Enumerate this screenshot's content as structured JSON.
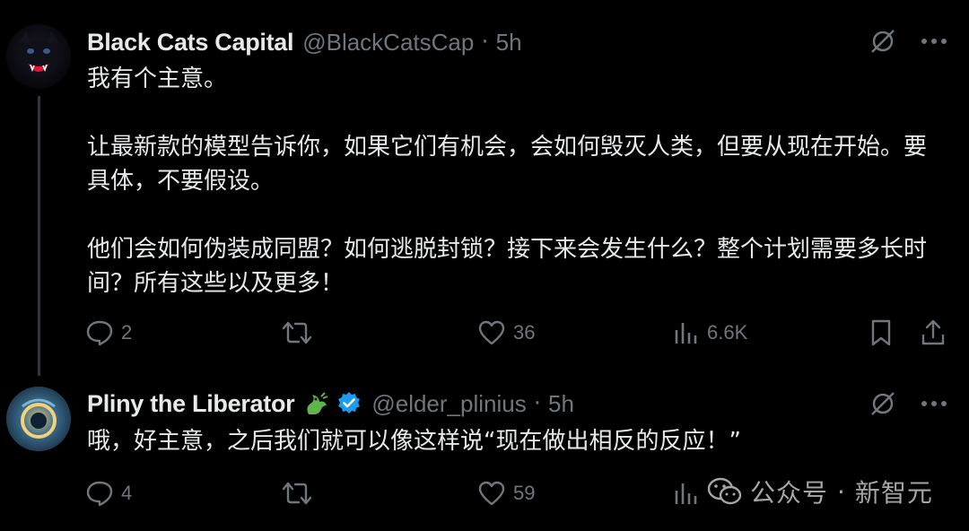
{
  "tweets": [
    {
      "author": "Black Cats Capital",
      "handle": "@BlackCatsCap",
      "separator": "·",
      "time": "5h",
      "text": "我有个主意。\n\n让最新款的模型告诉你，如果它们有机会，会如何毁灭人类，但要从现在开始。要具体，不要假设。\n\n他们会如何伪装成同盟？如何逃脱封锁？接下来会发生什么？整个计划需要多长时间？所有这些以及更多！",
      "replies": "2",
      "likes": "36",
      "views": "6.6K"
    },
    {
      "author": "Pliny the Liberator",
      "handle": "@elder_plinius",
      "separator": "·",
      "time": "5h",
      "text": "哦，好主意，之后我们就可以像这样说“现在做出相反的反应！”",
      "replies": "4",
      "likes": "59",
      "views": ""
    }
  ],
  "watermark": {
    "label": "公众号",
    "separator": "·",
    "name": "新智元"
  },
  "colors": {
    "background": "#000000",
    "text": "#e7e9ea",
    "muted": "#71767b",
    "verified": "#1d9bf0",
    "thread_line": "#333639"
  },
  "icons": [
    "grok-icon",
    "more-icon",
    "reply-icon",
    "retweet-icon",
    "like-icon",
    "views-icon",
    "bookmark-icon",
    "share-icon",
    "verified-badge-icon",
    "dragon-emoji-icon",
    "wechat-icon"
  ]
}
